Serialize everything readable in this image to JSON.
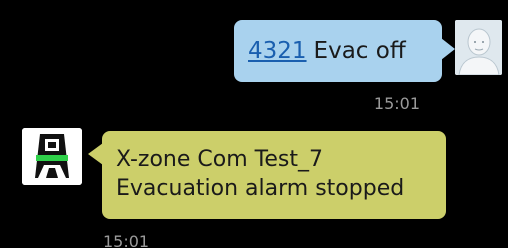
{
  "colors": {
    "background": "#000000",
    "outgoing_bubble": "#a9d2ee",
    "incoming_bubble": "#cccf6a",
    "link": "#1a5faf",
    "timestamp": "#9a9a9a"
  },
  "messages": [
    {
      "direction": "outgoing",
      "link_text": "4321",
      "text": "Evac off",
      "time": "15:01",
      "avatar_icon": "person-silhouette-icon"
    },
    {
      "direction": "incoming",
      "lines": [
        "X-zone Com Test_7",
        "Evacuation alarm stopped"
      ],
      "time": "15:01",
      "sender_icon": "x-zone-device-icon"
    }
  ]
}
